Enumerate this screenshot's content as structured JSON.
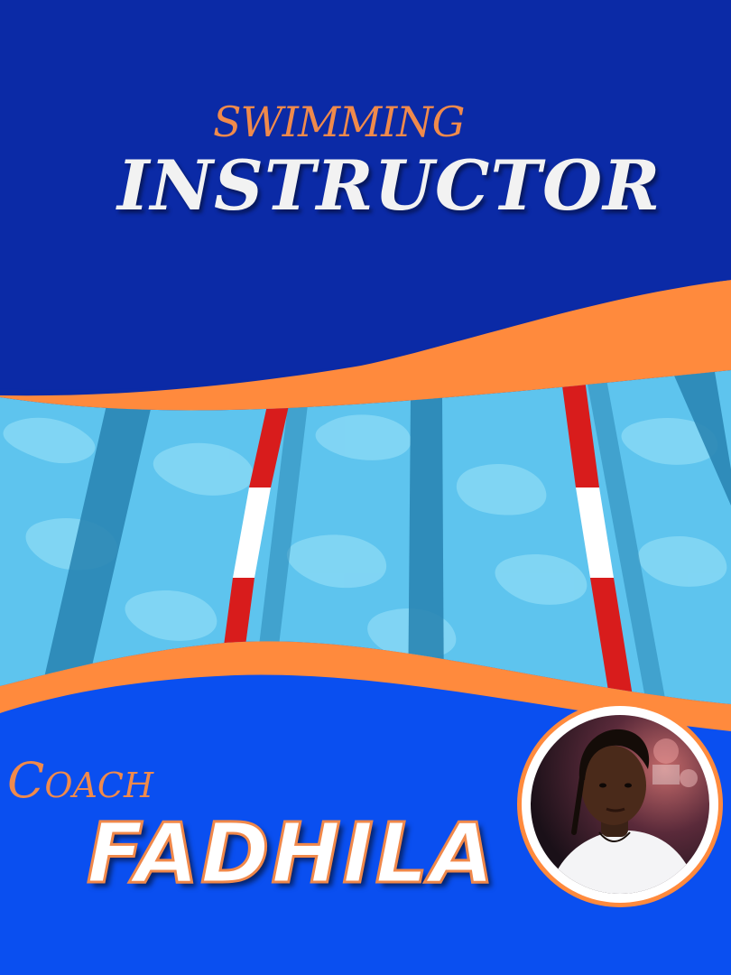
{
  "poster": {
    "title_top": "SWIMMING",
    "title_main": "INSTRUCTOR",
    "coach_label": "Coach",
    "coach_name": "FADHILA"
  },
  "colors": {
    "top_blue": "#0b2aa6",
    "bottom_blue": "#0a4ff0",
    "orange": "#ff8a3d",
    "water": "#5ec4ee",
    "water_light": "#86d8f5",
    "lane_dark": "#2a86b4",
    "rope_red": "#d81c1c",
    "title_top_color": "#f08a4b",
    "title_main_color": "#f2f2f2",
    "coach_color": "#f08a4b",
    "name_fill": "#ffffff"
  },
  "icons": {
    "avatar": "person-photo"
  }
}
